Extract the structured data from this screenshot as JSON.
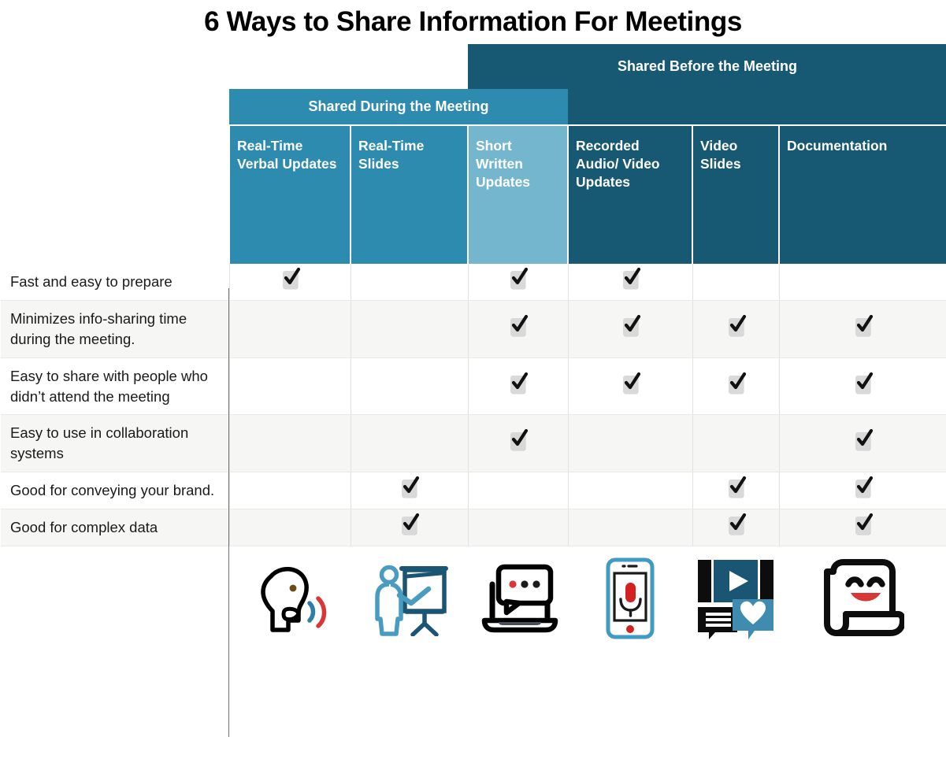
{
  "title": "6 Ways to Share Information For Meetings",
  "colors": {
    "dark_blue": "#175872",
    "mid_blue": "#2e8bb0",
    "light_blue": "#74b6cd",
    "row_alt": "#f6f6f4",
    "check_box": "#d9d9d9",
    "accent_red": "#d93636"
  },
  "groups": {
    "during": "Shared During the Meeting",
    "before": "Shared Before the Meeting"
  },
  "columns": [
    {
      "label": "Real-Time Verbal Updates",
      "group": "during",
      "shade": "mid",
      "icon": "speaking-head-icon"
    },
    {
      "label": "Real-Time Slides",
      "group": "during",
      "shade": "mid",
      "icon": "presenter-flipchart-icon"
    },
    {
      "label": "Short Written Updates",
      "group": "during",
      "shade": "light",
      "icon": "laptop-chat-icon"
    },
    {
      "label": "Recorded Audio/ Video Updates",
      "group": "before",
      "shade": "dark",
      "icon": "phone-microphone-icon"
    },
    {
      "label": "Video Slides",
      "group": "before",
      "shade": "dark",
      "icon": "video-play-comment-icon"
    },
    {
      "label": "Documentation",
      "group": "before",
      "shade": "dark",
      "icon": "document-smile-icon"
    }
  ],
  "rows": [
    {
      "label": "Fast and easy to prepare",
      "checks": [
        true,
        false,
        true,
        true,
        false,
        false
      ]
    },
    {
      "label": "Minimizes info-sharing time during the meeting.",
      "checks": [
        false,
        false,
        true,
        true,
        true,
        true
      ]
    },
    {
      "label": "Easy to share with people who didn’t attend the meeting",
      "checks": [
        false,
        false,
        true,
        true,
        true,
        true
      ]
    },
    {
      "label": "Easy to use in collaboration systems",
      "checks": [
        false,
        false,
        true,
        false,
        false,
        true
      ]
    },
    {
      "label": "Good for conveying your brand.",
      "checks": [
        false,
        true,
        false,
        false,
        true,
        true
      ]
    },
    {
      "label": "Good for complex data",
      "checks": [
        false,
        true,
        false,
        false,
        true,
        true
      ]
    }
  ],
  "check_symbol": "✔"
}
